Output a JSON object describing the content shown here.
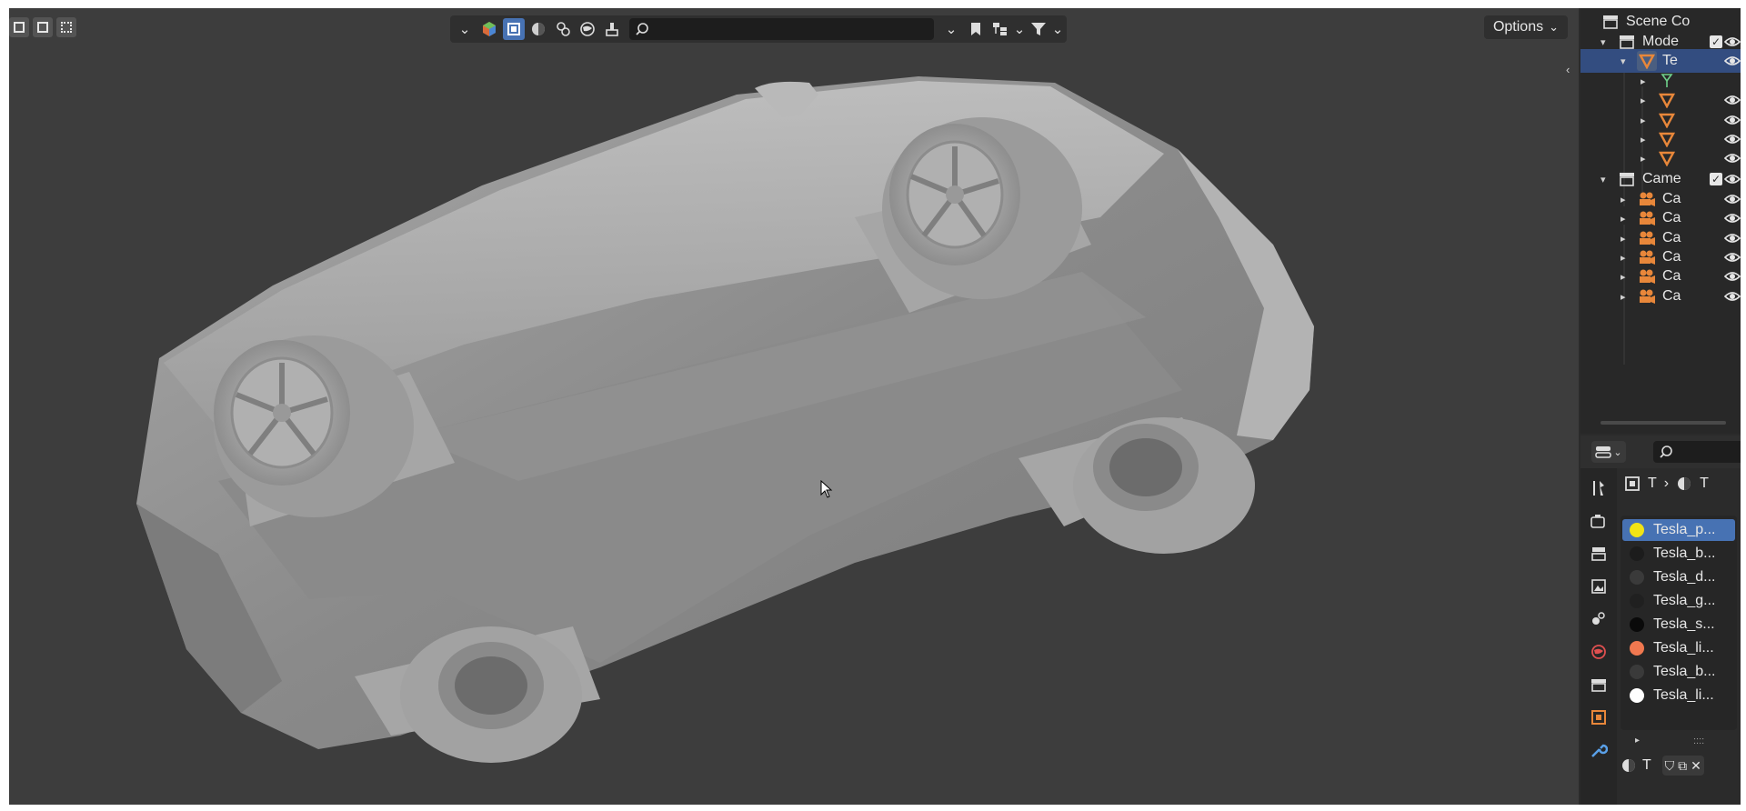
{
  "viewport": {
    "search_placeholder": "",
    "options_label": "Options",
    "icons": [
      "select-box-icon",
      "select-extend-icon",
      "select-subtract-icon",
      "chevron-down-icon",
      "object-type-icon",
      "mesh-icon",
      "material-icon",
      "light-icon",
      "world-icon",
      "brush-icon",
      "search-icon",
      "bookmark-icon",
      "hierarchy-icon",
      "filter-icon",
      "cursor-icon"
    ]
  },
  "outliner": {
    "rows": [
      {
        "label": "Scene Co",
        "icon": "collection-icon"
      },
      {
        "label": "Mode",
        "icon": "collection-icon",
        "checked": true
      },
      {
        "label": "Te",
        "icon": "mesh-object-icon",
        "selected": true
      },
      {
        "label": "",
        "icon": "vertex-group-icon"
      },
      {
        "label": "",
        "icon": "mesh-object-icon"
      },
      {
        "label": "",
        "icon": "mesh-object-icon"
      },
      {
        "label": "",
        "icon": "mesh-object-icon"
      },
      {
        "label": "",
        "icon": "mesh-object-icon"
      },
      {
        "label": "Came",
        "icon": "collection-icon",
        "checked": true
      },
      {
        "label": "Ca",
        "icon": "camera-icon"
      },
      {
        "label": "Ca",
        "icon": "camera-icon"
      },
      {
        "label": "Ca",
        "icon": "camera-icon"
      },
      {
        "label": "Ca",
        "icon": "camera-icon"
      },
      {
        "label": "Ca",
        "icon": "camera-icon"
      },
      {
        "label": "Ca",
        "icon": "camera-icon"
      }
    ]
  },
  "properties": {
    "breadcrumb": [
      "T",
      "T"
    ],
    "materials": [
      {
        "name": "Tesla_p...",
        "color": "#f2e414",
        "selected": true
      },
      {
        "name": "Tesla_b...",
        "color": "#1c1c1c"
      },
      {
        "name": "Tesla_d...",
        "color": "#3a3a3a"
      },
      {
        "name": "Tesla_g...",
        "color": "#202020"
      },
      {
        "name": "Tesla_s...",
        "color": "#0a0a0a"
      },
      {
        "name": "Tesla_li...",
        "color": "#f07850"
      },
      {
        "name": "Tesla_b...",
        "color": "#3a3a3a"
      },
      {
        "name": "Tesla_li...",
        "color": "#ffffff"
      }
    ],
    "list_footer": "::::",
    "slot_label": "T"
  },
  "colors": {
    "viewport_bg": "#3d3d3d",
    "panel_bg": "#282828",
    "accent": "#4772b3",
    "selected_row": "#334d80",
    "object_orange": "#e8873a"
  }
}
